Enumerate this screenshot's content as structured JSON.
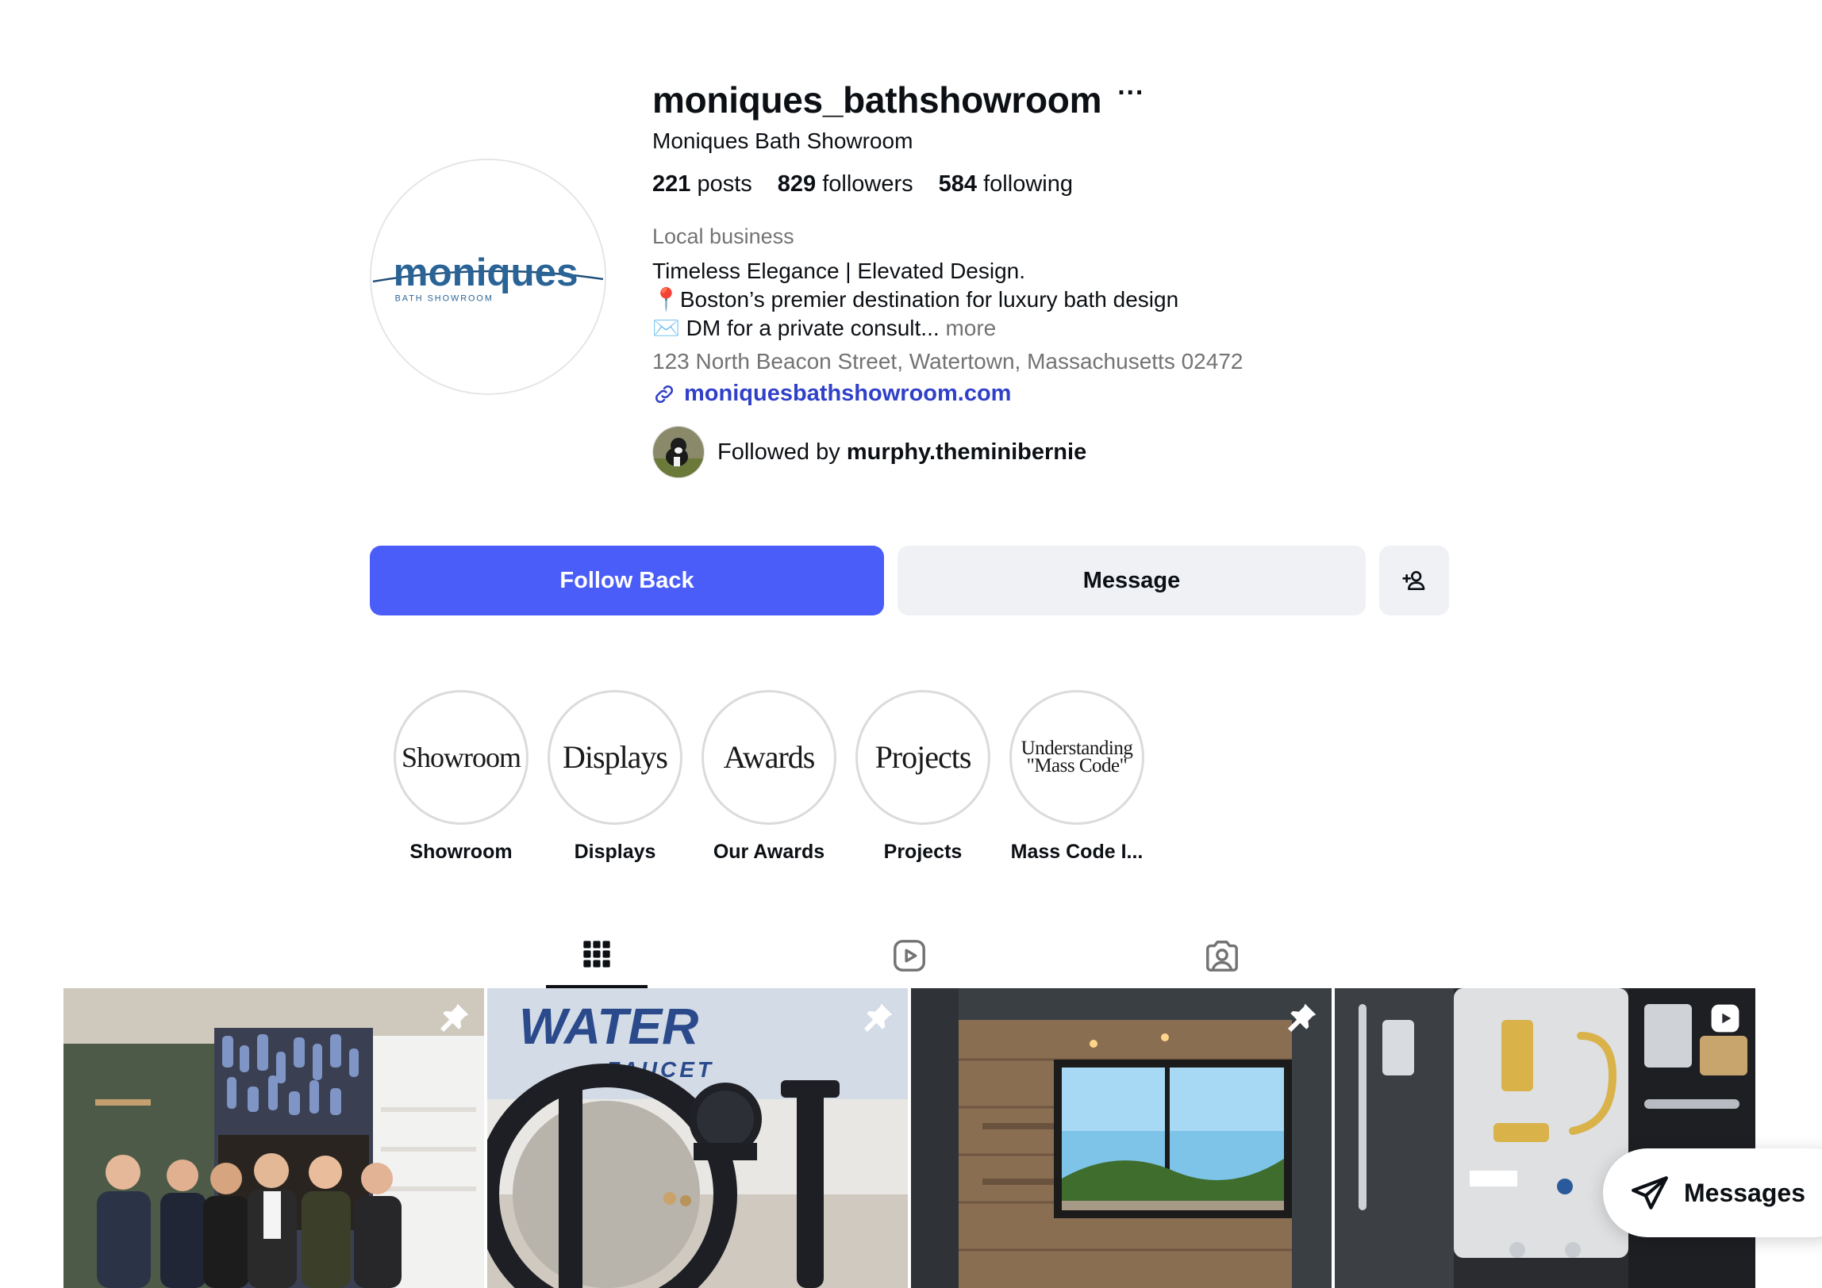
{
  "profile": {
    "username": "moniques_bathshowroom",
    "full_name": "Moniques Bath Showroom",
    "avatar_logo_text": "moniques",
    "avatar_logo_subtext": "BATH SHOWROOM",
    "stats": {
      "posts_count": "221",
      "posts_label": "posts",
      "followers_count": "829",
      "followers_label": "followers",
      "following_count": "584",
      "following_label": "following"
    },
    "category": "Local business",
    "bio_line1": "Timeless Elegance | Elevated Design.",
    "bio_line2": "📍Boston’s premier destination for luxury bath design",
    "bio_line3": "✉️ DM for a private consult...",
    "bio_more": "more",
    "address": "123 North Beacon Street, Watertown, Massachusetts 02472",
    "website": "moniquesbathshowroom.com",
    "followed_by_prefix": "Followed by",
    "followed_by_name": "murphy.theminibernie"
  },
  "actions": {
    "follow_back": "Follow Back",
    "message": "Message",
    "add_user_icon": "person-add-icon"
  },
  "highlights": [
    {
      "cover_text": "Showroom",
      "label": "Showroom"
    },
    {
      "cover_text": "Displays",
      "label": "Displays"
    },
    {
      "cover_text": "Awards",
      "label": "Our Awards"
    },
    {
      "cover_text": "Projects",
      "label": "Projects"
    },
    {
      "cover_text_line1": "Understanding",
      "cover_text_line2": "\"Mass Code\"",
      "label": "Mass Code I..."
    }
  ],
  "tabs": [
    {
      "icon": "grid-icon",
      "active": true
    },
    {
      "icon": "reels-icon",
      "active": false
    },
    {
      "icon": "tagged-icon",
      "active": false
    }
  ],
  "posts": [
    {
      "badge": "pin-icon",
      "scene": "team-photo"
    },
    {
      "badge": "pin-icon",
      "scene": "faucet-closeup",
      "sign_text": "WATER",
      "sign_subtext": "FAUCET"
    },
    {
      "badge": "pin-icon",
      "scene": "vanity-window"
    },
    {
      "badge": "reel-icon",
      "scene": "fixtures-display"
    }
  ],
  "messages_pill": {
    "label": "Messages",
    "icon": "send-icon"
  },
  "colors": {
    "primary_button": "#4a5df9",
    "secondary_button": "#eff1f4",
    "link": "#3040c8",
    "muted_text": "#737373",
    "logo_blue": "#1f4e79"
  }
}
